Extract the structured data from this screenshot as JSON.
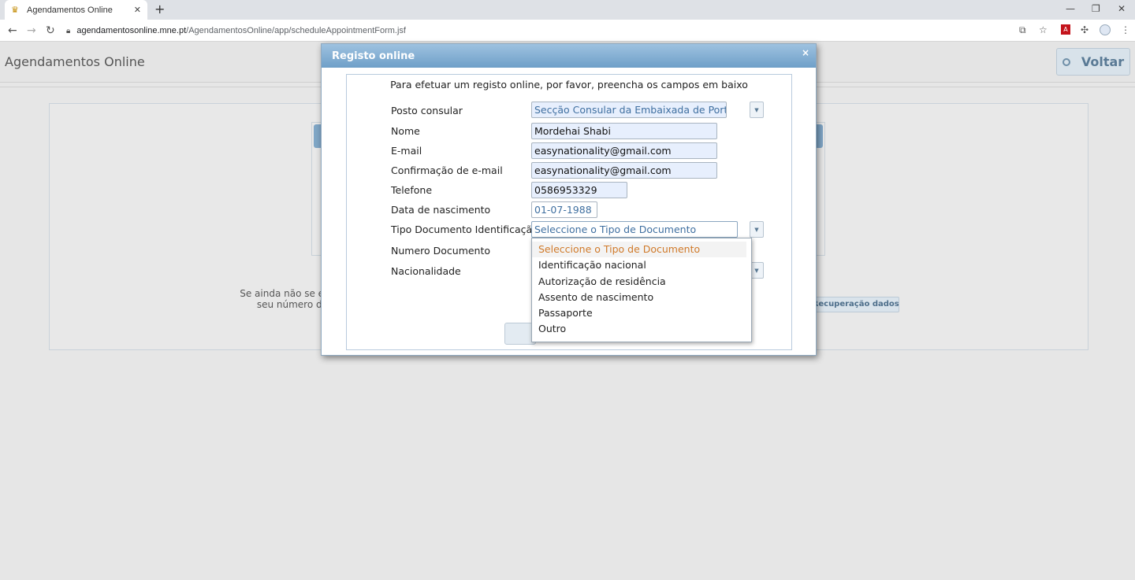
{
  "browser": {
    "tab_title": "Agendamentos Online",
    "tab_close": "✕",
    "new_tab": "+",
    "url_host": "agendamentosonline.mne.pt",
    "url_path": "/AgendamentosOnline/app/scheduleAppointmentForm.jsf",
    "window_controls": [
      "—",
      "❐",
      "✕"
    ],
    "icons": [
      "back-icon",
      "forward-icon",
      "reload-icon",
      "lock-icon",
      "translate-icon",
      "star-icon",
      "pdf-icon",
      "extensions-icon",
      "profile-icon",
      "menu-icon"
    ]
  },
  "app": {
    "title": "Agendamentos Online",
    "back_button": "Voltar",
    "hint_line1": "Se ainda não se er",
    "hint_line2": "seu número de",
    "recovery_button": "/Recuperação dados"
  },
  "dialog": {
    "title": "Registo online",
    "close": "×",
    "intro": "Para efetuar um registo online, por favor, preencha os campos em baixo",
    "fields": {
      "posto_label": "Posto consular",
      "posto_value": "Secção Consular da Embaixada de Portugal",
      "nome_label": "Nome",
      "nome_value": "Mordehai Shabi",
      "email_label": "E-mail",
      "email_value": "easynationality@gmail.com",
      "email_confirm_label": "Confirmação de e-mail",
      "email_confirm_value": "easynationality@gmail.com",
      "telefone_label": "Telefone",
      "telefone_value": "0586953329",
      "nascimento_label": "Data de nascimento",
      "nascimento_value": "01-07-1988",
      "tipo_doc_label": "Tipo Documento Identificação",
      "tipo_doc_value": "Seleccione o Tipo de Documento",
      "numero_doc_label": "Numero Documento",
      "nacionalidade_label": "Nacionalidade"
    }
  },
  "dropdown": {
    "options": [
      "Seleccione o Tipo de Documento",
      "Identificação nacional",
      "Autorização de residência",
      "Assento de nascimento",
      "Passaporte",
      "Outro"
    ],
    "selected_index": 0,
    "selected_color": "#d07a2a"
  }
}
